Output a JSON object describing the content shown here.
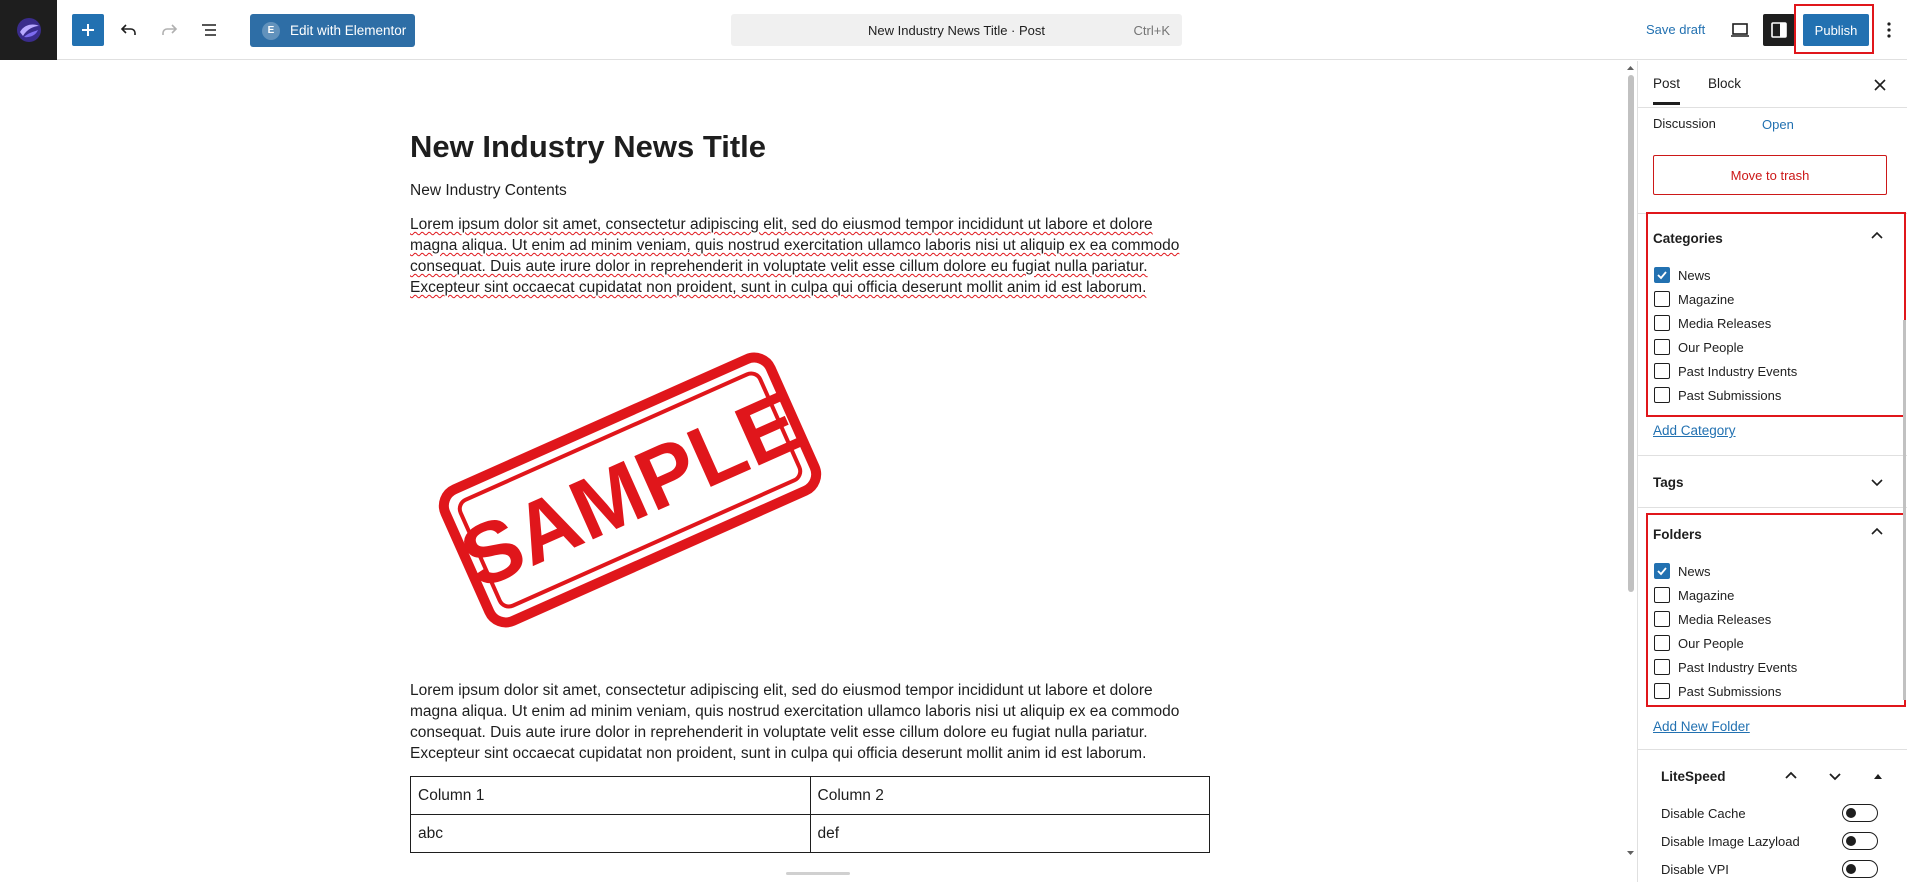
{
  "toolbar": {
    "elementor_label": "Edit with Elementor",
    "doc_title": "New Industry News Title · Post",
    "shortcut": "Ctrl+K",
    "save_draft": "Save draft",
    "publish": "Publish"
  },
  "post": {
    "title": "New Industry News Title",
    "subtitle": "New Industry Contents",
    "paragraph1": [
      "Lorem ipsum dolor sit amet, consectetur adipiscing elit, sed do eiusmod tempor incididunt ut labore et dolore",
      "magna aliqua. Ut enim ad minim veniam, quis nostrud exercitation ullamco laboris nisi ut aliquip ex ea commodo",
      "consequat. Duis aute irure dolor in reprehenderit in voluptate velit esse cillum dolore eu fugiat nulla pariatur.",
      "Excepteur sint occaecat cupidatat non proident, sunt in culpa qui officia deserunt mollit anim id est laborum."
    ],
    "paragraph2": [
      "Lorem ipsum dolor sit amet, consectetur adipiscing elit, sed do eiusmod tempor incididunt ut labore et dolore",
      "magna aliqua. Ut enim ad minim veniam, quis nostrud exercitation ullamco laboris nisi ut aliquip ex ea commodo",
      "consequat. Duis aute irure dolor in reprehenderit in voluptate velit esse cillum dolore eu fugiat nulla pariatur.",
      "Excepteur sint occaecat cupidatat non proident, sunt in culpa qui officia deserunt mollit anim id est laborum."
    ],
    "image_text": "SAMPLE",
    "table": [
      [
        "Column 1",
        "Column 2"
      ],
      [
        "abc",
        "def"
      ]
    ]
  },
  "sidebar": {
    "tabs": [
      "Post",
      "Block"
    ],
    "discussion_label": "Discussion",
    "discussion_value": "Open",
    "trash": "Move to trash",
    "categories": {
      "title": "Categories",
      "items": [
        {
          "label": "News",
          "checked": true
        },
        {
          "label": "Magazine",
          "checked": false
        },
        {
          "label": "Media Releases",
          "checked": false
        },
        {
          "label": "Our People",
          "checked": false
        },
        {
          "label": "Past Industry Events",
          "checked": false
        },
        {
          "label": "Past Submissions",
          "checked": false
        }
      ],
      "add": "Add Category"
    },
    "tags_title": "Tags",
    "folders": {
      "title": "Folders",
      "items": [
        {
          "label": "News",
          "checked": true
        },
        {
          "label": "Magazine",
          "checked": false
        },
        {
          "label": "Media Releases",
          "checked": false
        },
        {
          "label": "Our People",
          "checked": false
        },
        {
          "label": "Past Industry Events",
          "checked": false
        },
        {
          "label": "Past Submissions",
          "checked": false
        }
      ],
      "add": "Add New Folder"
    },
    "litespeed": {
      "title": "LiteSpeed",
      "options": [
        "Disable Cache",
        "Disable Image Lazyload",
        "Disable VPI"
      ]
    }
  },
  "colors": {
    "accent": "#2271b1",
    "highlight": "#e0161b",
    "danger": "#cc1818"
  }
}
